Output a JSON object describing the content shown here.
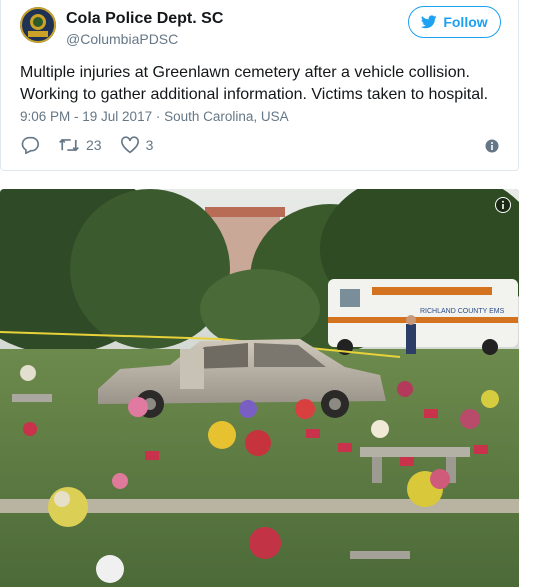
{
  "tweet": {
    "display_name": "Cola Police Dept. SC",
    "handle": "@ColumbiaPDSC",
    "follow_label": "Follow",
    "text": "Multiple injuries at Greenlawn cemetery after a vehicle collision. Working to gather additional information. Victims taken to hospital.",
    "timestamp": "9:06 PM - 19 Jul 2017",
    "location": "South Carolina, USA",
    "retweet_count": "23",
    "like_count": "3",
    "avatar_badge_text": "POLICE",
    "twitter_color": "#1da1f2"
  },
  "photo": {
    "icons": [
      "info-icon"
    ],
    "sign_text": "RICHLAND COUNTY EMS"
  }
}
